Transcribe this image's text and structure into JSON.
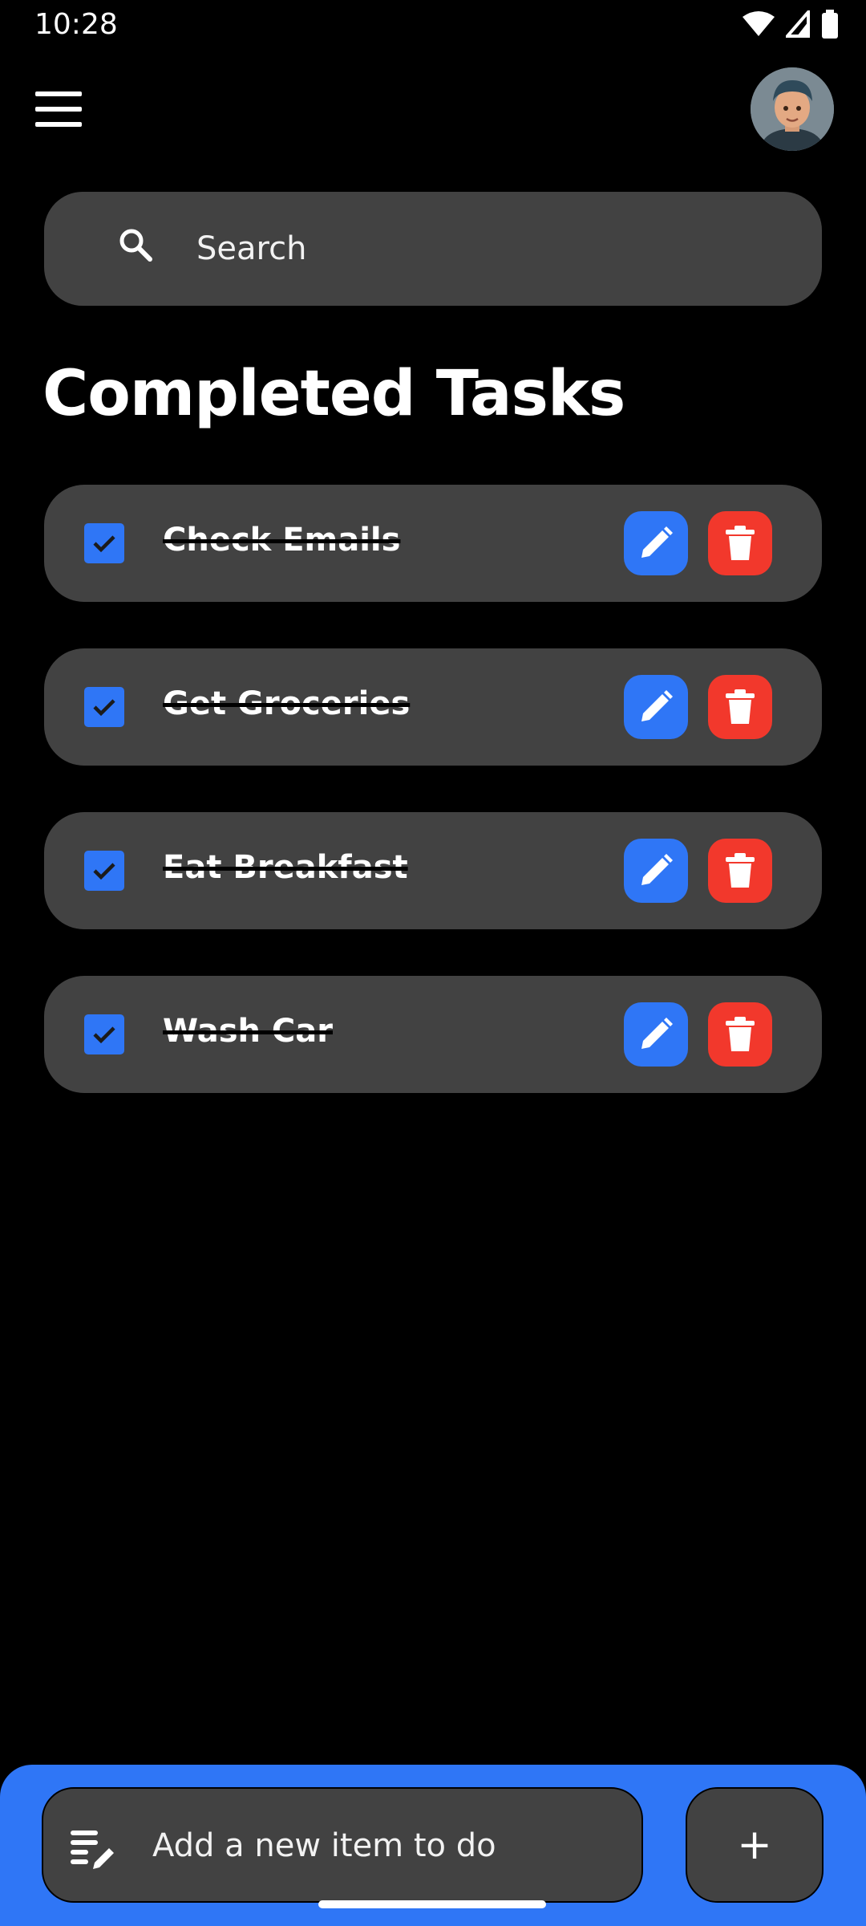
{
  "status_bar": {
    "time": "10:28",
    "icons": [
      "wifi-icon",
      "signal-icon",
      "battery-icon"
    ]
  },
  "app_bar": {
    "menu_icon": "hamburger-menu-icon",
    "avatar": "user-avatar"
  },
  "search": {
    "placeholder": "Search",
    "value": "",
    "icon": "search-icon"
  },
  "page": {
    "title": "Completed Tasks"
  },
  "tasks": [
    {
      "label": "Check Emails",
      "completed": true
    },
    {
      "label": "Get Groceries",
      "completed": true
    },
    {
      "label": "Eat Breakfast",
      "completed": true
    },
    {
      "label": "Wash Car",
      "completed": true
    }
  ],
  "task_actions": {
    "edit_icon": "pencil-icon",
    "delete_icon": "trash-icon"
  },
  "bottom_bar": {
    "add_placeholder": "Add a new item to do",
    "add_value": "",
    "add_button_label": "+",
    "input_icon": "note-edit-icon"
  },
  "colors": {
    "background": "#000000",
    "card": "#424242",
    "accent_blue": "#2f76f6",
    "delete_red": "#f2382c",
    "text": "#ffffff"
  }
}
